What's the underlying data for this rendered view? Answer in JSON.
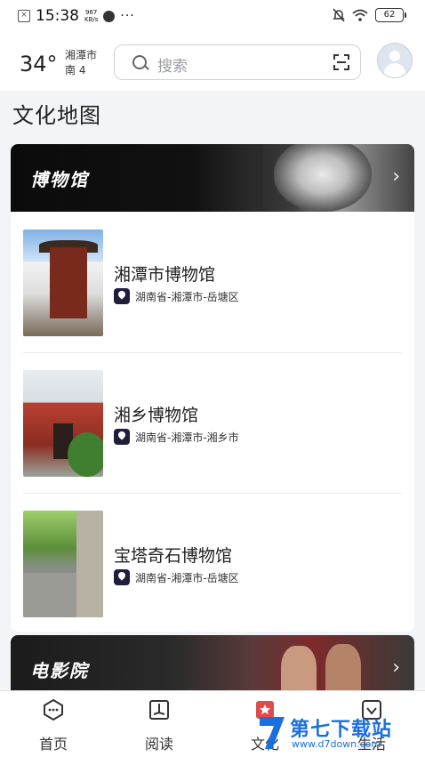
{
  "status_bar": {
    "time": "15:38",
    "speed_value": "967",
    "speed_unit": "KB/s",
    "more": "···",
    "battery": "62"
  },
  "header": {
    "temperature": "34°",
    "city": "湘潭市",
    "wind": "南 4",
    "search_placeholder": "搜索"
  },
  "section_title": "文化地图",
  "museum_banner": {
    "title": "博物馆",
    "chevron": "›"
  },
  "museums": [
    {
      "name": "湘潭市博物馆",
      "location": "湖南省-湘潭市-岳塘区"
    },
    {
      "name": "湘乡博物馆",
      "location": "湖南省-湘潭市-湘乡市"
    },
    {
      "name": "宝塔奇石博物馆",
      "location": "湖南省-湘潭市-岳塘区"
    }
  ],
  "cinema_banner": {
    "title": "电影院",
    "chevron": "›"
  },
  "tabs": [
    {
      "label": "首页",
      "icon": "home-chat-icon"
    },
    {
      "label": "阅读",
      "icon": "book-icon"
    },
    {
      "label": "文化",
      "icon": "star-badge-icon"
    },
    {
      "label": "生活",
      "icon": "heart-box-icon"
    }
  ],
  "watermark": {
    "text": "第七下载站",
    "url": "www.d7down.com"
  },
  "colors": {
    "accent": "#1e1f3a",
    "watermark": "#1a6fe0",
    "background": "#f3f4f7"
  }
}
